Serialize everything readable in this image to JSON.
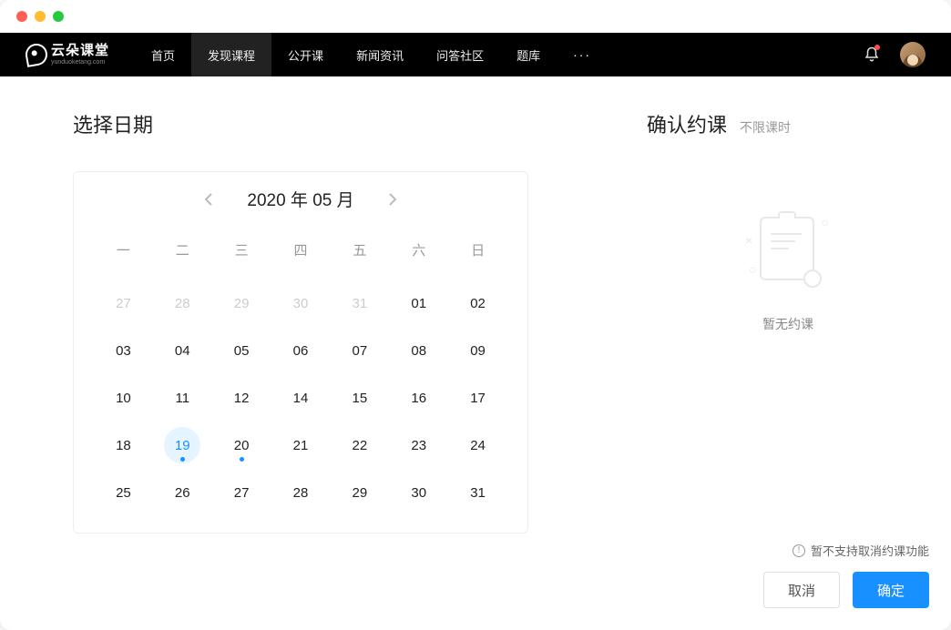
{
  "brand": {
    "title": "云朵课堂",
    "sub": "yunduoketang.com"
  },
  "nav": {
    "items": [
      {
        "label": "首页",
        "active": false
      },
      {
        "label": "发现课程",
        "active": true
      },
      {
        "label": "公开课",
        "active": false
      },
      {
        "label": "新闻资讯",
        "active": false
      },
      {
        "label": "问答社区",
        "active": false
      },
      {
        "label": "题库",
        "active": false
      }
    ],
    "more": "···"
  },
  "left": {
    "title": "选择日期",
    "calendar": {
      "header": "2020 年 05 月",
      "dow": [
        "一",
        "二",
        "三",
        "四",
        "五",
        "六",
        "日"
      ],
      "days": [
        {
          "n": "27",
          "other": true
        },
        {
          "n": "28",
          "other": true
        },
        {
          "n": "29",
          "other": true
        },
        {
          "n": "30",
          "other": true
        },
        {
          "n": "31",
          "other": true
        },
        {
          "n": "01"
        },
        {
          "n": "02"
        },
        {
          "n": "03"
        },
        {
          "n": "04"
        },
        {
          "n": "05"
        },
        {
          "n": "06"
        },
        {
          "n": "07"
        },
        {
          "n": "08"
        },
        {
          "n": "09"
        },
        {
          "n": "10"
        },
        {
          "n": "11"
        },
        {
          "n": "12"
        },
        {
          "n": "14"
        },
        {
          "n": "15"
        },
        {
          "n": "16"
        },
        {
          "n": "17"
        },
        {
          "n": "18"
        },
        {
          "n": "19",
          "today": true,
          "event": true
        },
        {
          "n": "20",
          "event": true
        },
        {
          "n": "21"
        },
        {
          "n": "22"
        },
        {
          "n": "23"
        },
        {
          "n": "24"
        },
        {
          "n": "25"
        },
        {
          "n": "26"
        },
        {
          "n": "27"
        },
        {
          "n": "28"
        },
        {
          "n": "29"
        },
        {
          "n": "30"
        },
        {
          "n": "31"
        }
      ]
    }
  },
  "right": {
    "title": "确认约课",
    "sub": "不限课时",
    "empty": "暂无约课",
    "footer_note": "暂不支持取消约课功能",
    "cancel": "取消",
    "confirm": "确定"
  }
}
